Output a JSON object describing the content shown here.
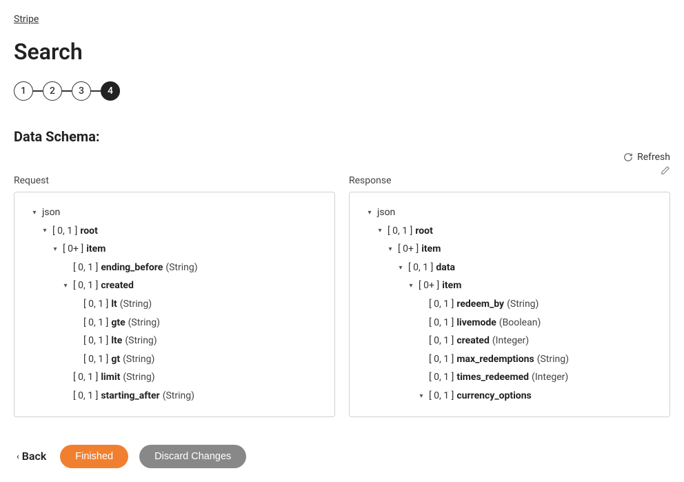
{
  "breadcrumb": "Stripe",
  "title": "Search",
  "steps": {
    "s1": "1",
    "s2": "2",
    "s3": "3",
    "s4": "4"
  },
  "section_title": "Data Schema:",
  "request_label": "Request",
  "response_label": "Response",
  "refresh_label": "Refresh",
  "occ": {
    "o01": "[ 0, 1 ]",
    "o0p": "[ 0+ ]"
  },
  "common": {
    "json": "json",
    "root": "root",
    "item": "item"
  },
  "req": {
    "ending_before": {
      "name": "ending_before",
      "type": "(String)"
    },
    "created": {
      "name": "created"
    },
    "lt": {
      "name": "lt",
      "type": "(String)"
    },
    "gte": {
      "name": "gte",
      "type": "(String)"
    },
    "lte": {
      "name": "lte",
      "type": "(String)"
    },
    "gt": {
      "name": "gt",
      "type": "(String)"
    },
    "limit": {
      "name": "limit",
      "type": "(String)"
    },
    "starting_after": {
      "name": "starting_after",
      "type": "(String)"
    }
  },
  "res": {
    "data": {
      "name": "data"
    },
    "redeem_by": {
      "name": "redeem_by",
      "type": "(String)"
    },
    "livemode": {
      "name": "livemode",
      "type": "(Boolean)"
    },
    "created": {
      "name": "created",
      "type": "(Integer)"
    },
    "max_redemptions": {
      "name": "max_redemptions",
      "type": "(String)"
    },
    "times_redeemed": {
      "name": "times_redeemed",
      "type": "(Integer)"
    },
    "currency_options": {
      "name": "currency_options"
    }
  },
  "footer": {
    "back": "Back",
    "finished": "Finished",
    "discard": "Discard Changes"
  }
}
